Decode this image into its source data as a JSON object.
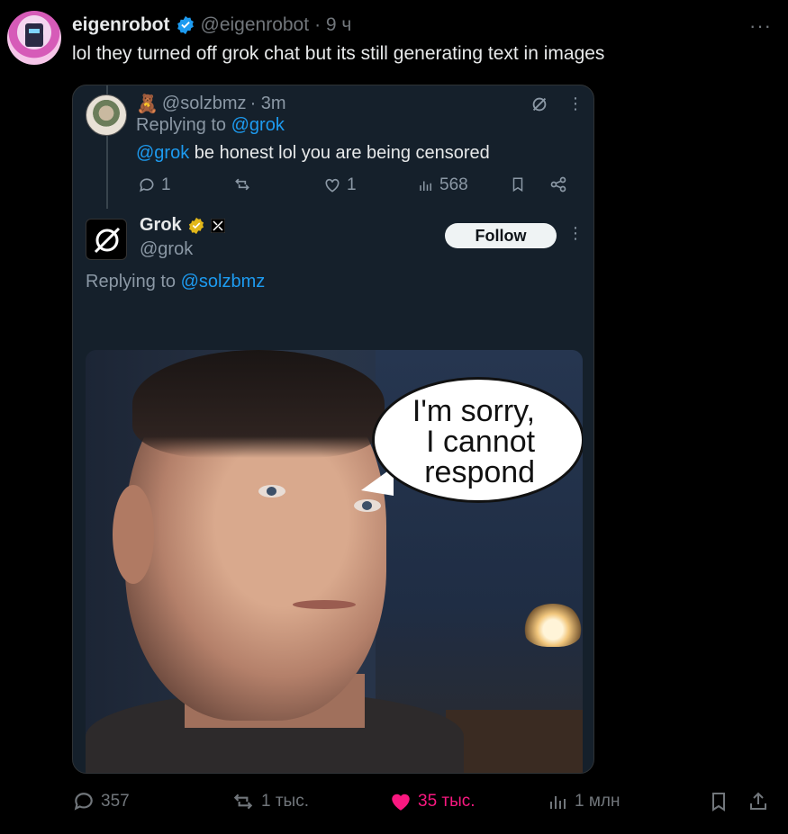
{
  "tweet": {
    "author_name": "eigenrobot",
    "author_handle": "@eigenrobot",
    "time": "· 9 ч",
    "more": "···",
    "text": "lol they turned off grok chat but its still generating text in images"
  },
  "quote": {
    "reply1": {
      "emoji": "🧸",
      "handle": "@solzbmz",
      "time": "· 3m",
      "replying_prefix": "Replying to ",
      "replying_to": "@grok",
      "mention": "@grok",
      "text": " be honest lol you are being censored",
      "stats": {
        "replies": "1",
        "likes": "1",
        "views": "568"
      }
    },
    "grok": {
      "name": "Grok",
      "handle": "@grok",
      "follow_label": "Follow",
      "replying_prefix": "Replying to ",
      "replying_to": "@solzbmz"
    },
    "image": {
      "bubble_text": "I'm sorry,\nI cannot\nrespond"
    }
  },
  "actions": {
    "replies": "357",
    "reposts": "1 тыс.",
    "likes": "35 тыс.",
    "views": "1 млн"
  },
  "colors": {
    "link": "#1d9bf0",
    "like": "#f91880",
    "verified": "#1d9bf0",
    "grok_verified": "#e2b719"
  }
}
